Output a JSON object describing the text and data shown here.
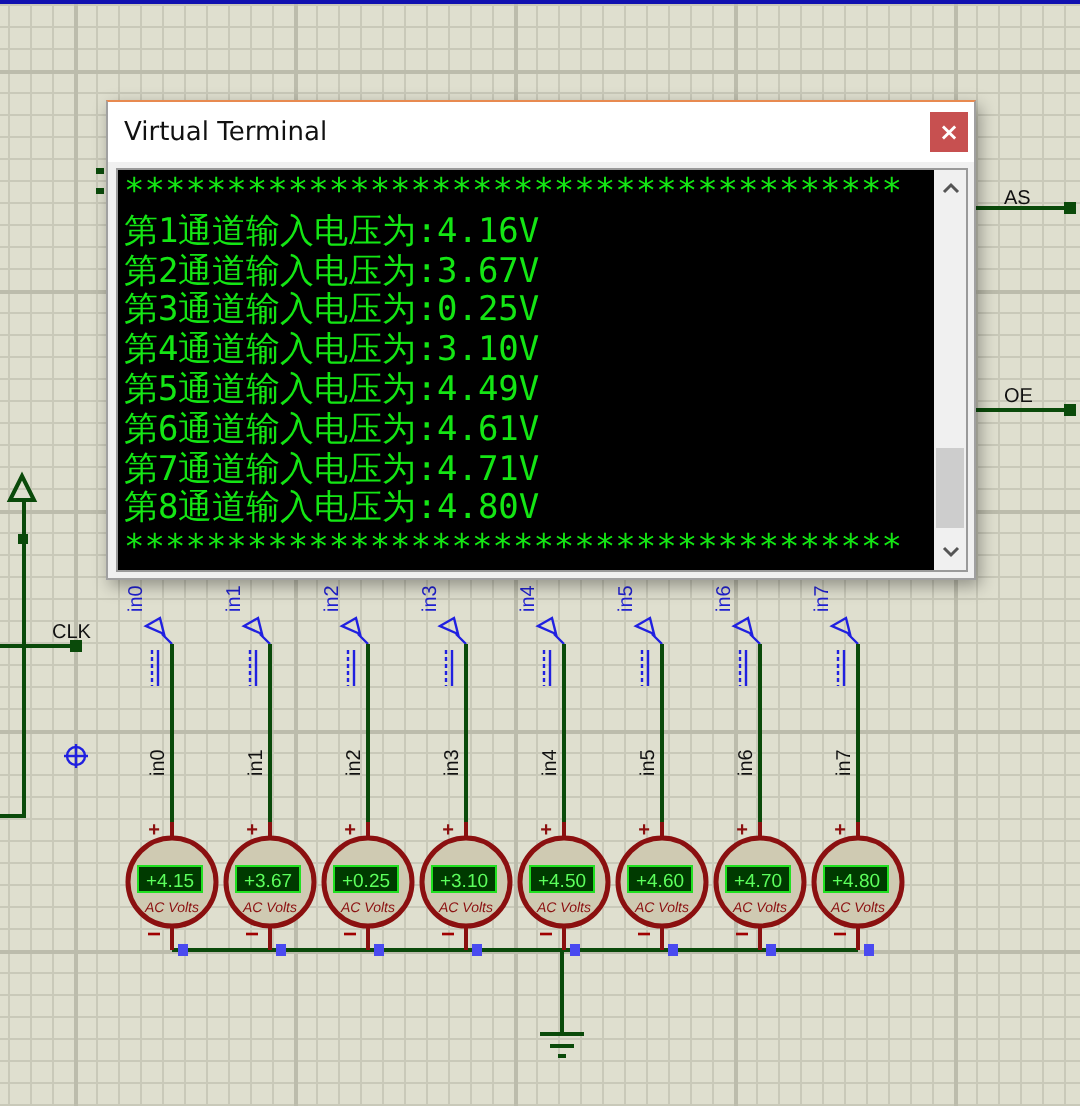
{
  "window": {
    "title": "Virtual Terminal",
    "close": "×"
  },
  "terminal": {
    "lines": [
      "**************************************",
      "第1通道输入电压为:4.16V",
      "第2通道输入电压为:3.67V",
      "第3通道输入电压为:0.25V",
      "第4通道输入电压为:3.10V",
      "第5通道输入电压为:4.49V",
      "第6通道输入电压为:4.61V",
      "第7通道输入电压为:4.71V",
      "第8通道输入电压为:4.80V",
      "**************************************"
    ]
  },
  "net_labels": [
    {
      "text": "CLK"
    },
    {
      "text": "AS"
    },
    {
      "text": "OE"
    }
  ],
  "channels": [
    {
      "terminal_label": "in0",
      "wire_label": "in0",
      "reading": "+4.15",
      "unit": "AC Volts",
      "plus": "+",
      "minus": "−"
    },
    {
      "terminal_label": "in1",
      "wire_label": "in1",
      "reading": "+3.67",
      "unit": "AC Volts",
      "plus": "+",
      "minus": "−"
    },
    {
      "terminal_label": "in2",
      "wire_label": "in2",
      "reading": "+0.25",
      "unit": "AC Volts",
      "plus": "+",
      "minus": "−"
    },
    {
      "terminal_label": "in3",
      "wire_label": "in3",
      "reading": "+3.10",
      "unit": "AC Volts",
      "plus": "+",
      "minus": "−"
    },
    {
      "terminal_label": "in4",
      "wire_label": "in4",
      "reading": "+4.50",
      "unit": "AC Volts",
      "plus": "+",
      "minus": "−"
    },
    {
      "terminal_label": "in5",
      "wire_label": "in5",
      "reading": "+4.60",
      "unit": "AC Volts",
      "plus": "+",
      "minus": "−"
    },
    {
      "terminal_label": "in6",
      "wire_label": "in6",
      "reading": "+4.70",
      "unit": "AC Volts",
      "plus": "+",
      "minus": "−"
    },
    {
      "terminal_label": "in7",
      "wire_label": "in7",
      "reading": "+4.80",
      "unit": "AC Volts",
      "plus": "+",
      "minus": "−"
    }
  ]
}
